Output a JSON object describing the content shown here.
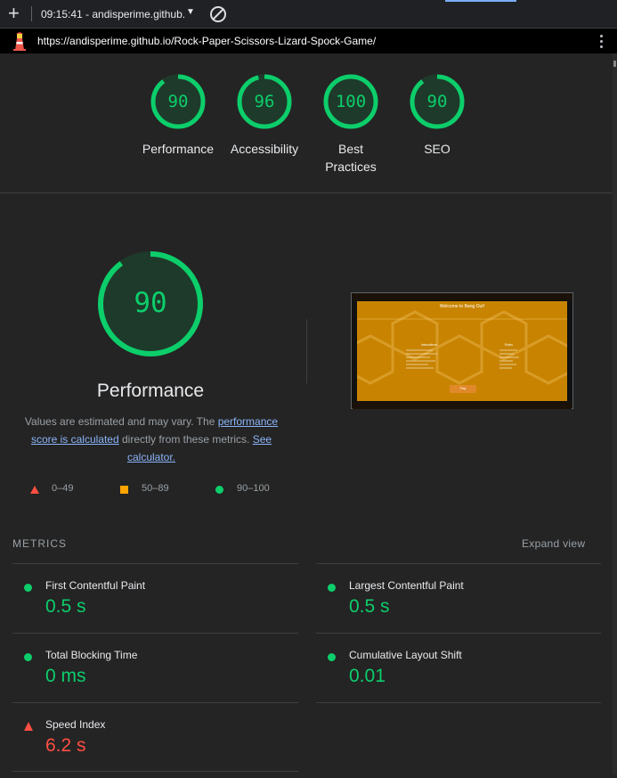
{
  "toolbar": {
    "report_label": "09:15:41 - andisperime.github.",
    "add_icon": "plus-icon",
    "clear_icon": "block-icon"
  },
  "urlbar": {
    "url": "https://andisperime.github.io/Rock-Paper-Scissors-Lizard-Spock-Game/",
    "icon": "lighthouse-icon"
  },
  "categories": [
    {
      "score": "90",
      "label": "Performance",
      "fraction": 0.9
    },
    {
      "score": "96",
      "label": "Accessibility",
      "fraction": 0.96
    },
    {
      "score": "100",
      "label": "Best Practices",
      "fraction": 1.0
    },
    {
      "score": "90",
      "label": "SEO",
      "fraction": 0.9
    }
  ],
  "performance": {
    "score": "90",
    "fraction": 0.9,
    "title": "Performance",
    "desc_prefix": "Values are estimated and may vary. The ",
    "desc_link1": "performance score is calculated",
    "desc_middle": " directly from these metrics. ",
    "desc_link2": "See calculator."
  },
  "legend": {
    "poor": "0–49",
    "average": "50–89",
    "good": "90–100"
  },
  "screenshot": {
    "title": "Welcome to Bang Out!",
    "col1_heading": "Instructions",
    "col2_heading": "Rules",
    "button": "Play"
  },
  "metrics": {
    "heading": "METRICS",
    "expand_label": "Expand view",
    "items": [
      {
        "title": "First Contentful Paint",
        "value": "0.5 s",
        "status": "good"
      },
      {
        "title": "Largest Contentful Paint",
        "value": "0.5 s",
        "status": "good"
      },
      {
        "title": "Total Blocking Time",
        "value": "0 ms",
        "status": "good"
      },
      {
        "title": "Cumulative Layout Shift",
        "value": "0.01",
        "status": "good"
      },
      {
        "title": "Speed Index",
        "value": "6.2 s",
        "status": "poor"
      }
    ]
  },
  "colors": {
    "good": "#0cce6b",
    "average": "#ffa400",
    "poor": "#ff4e42",
    "link": "#8ab4f8"
  }
}
